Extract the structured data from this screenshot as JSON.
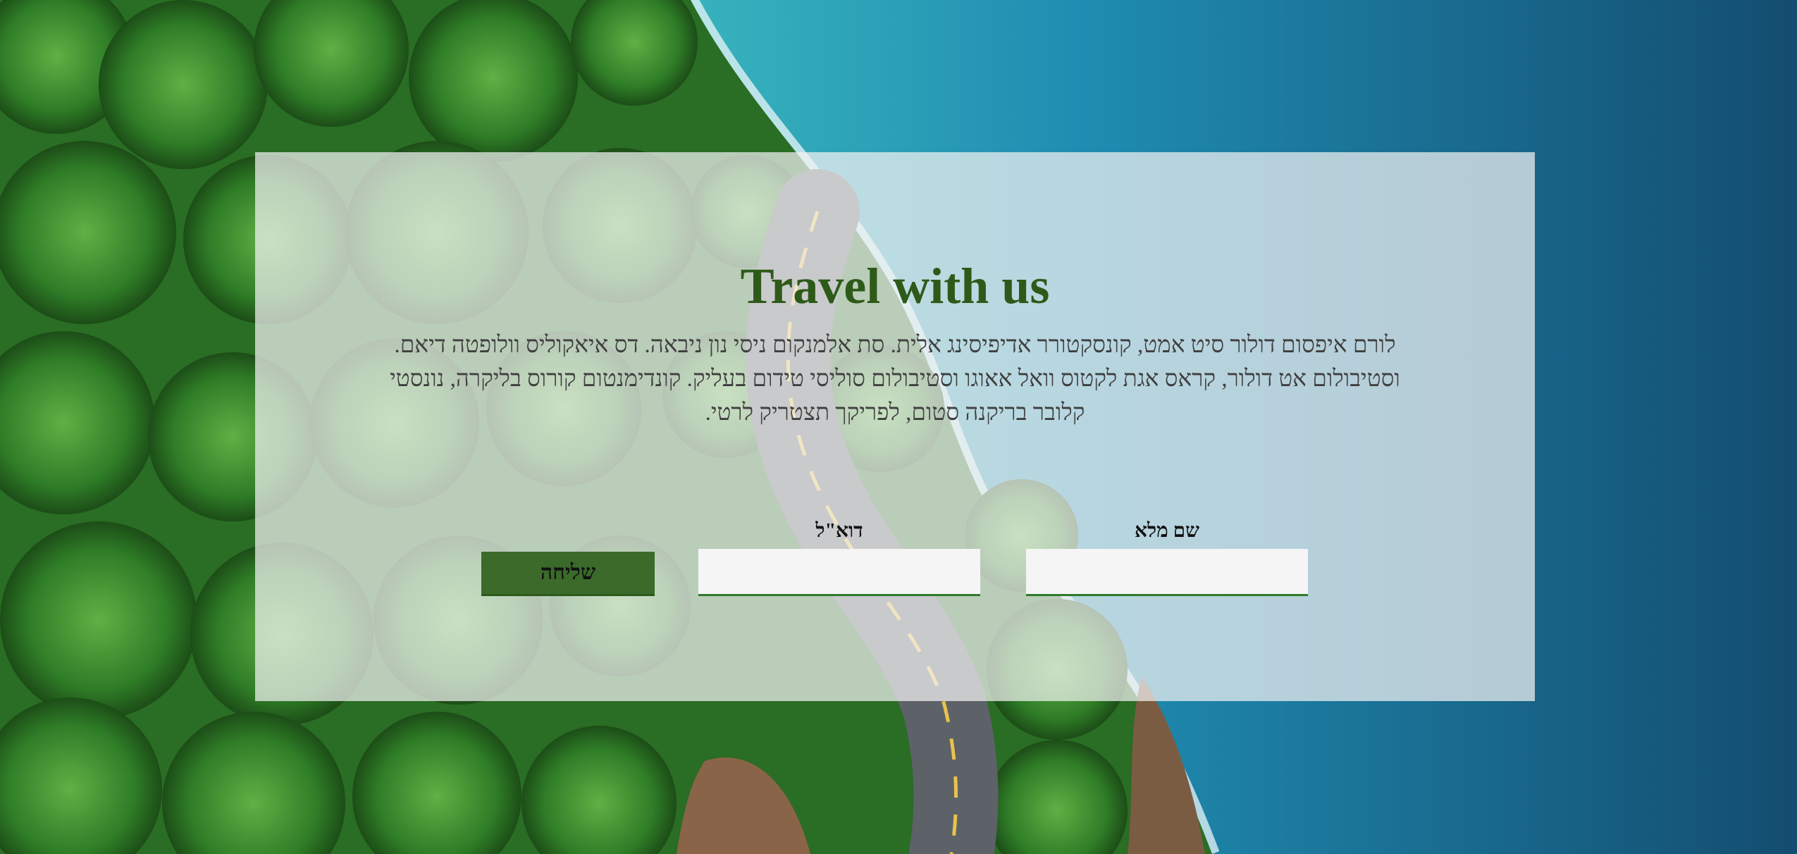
{
  "hero": {
    "title": "Travel with us",
    "description": "לורם איפסום דולור סיט אמט, קונסקטורר אדיפיסינג אלית. סת אלמנקום ניסי נון ניבאה. דס איאקוליס וולופטה דיאם. וסטיבולום אט דולור, קראס אגת לקטוס וואל אאוגו וסטיבולום סוליסי טידום בעליק. קונדימנטום קורוס בליקרה, נונסטי קלובר בריקנה סטום, לפריקך תצטריק לרטי."
  },
  "form": {
    "name_label": "שם מלא",
    "email_label": "דוא\"ל",
    "submit_label": "שליחה"
  },
  "colors": {
    "title": "#2d5a18",
    "accent": "#2f7a2a",
    "button": "#3b6a2a"
  }
}
